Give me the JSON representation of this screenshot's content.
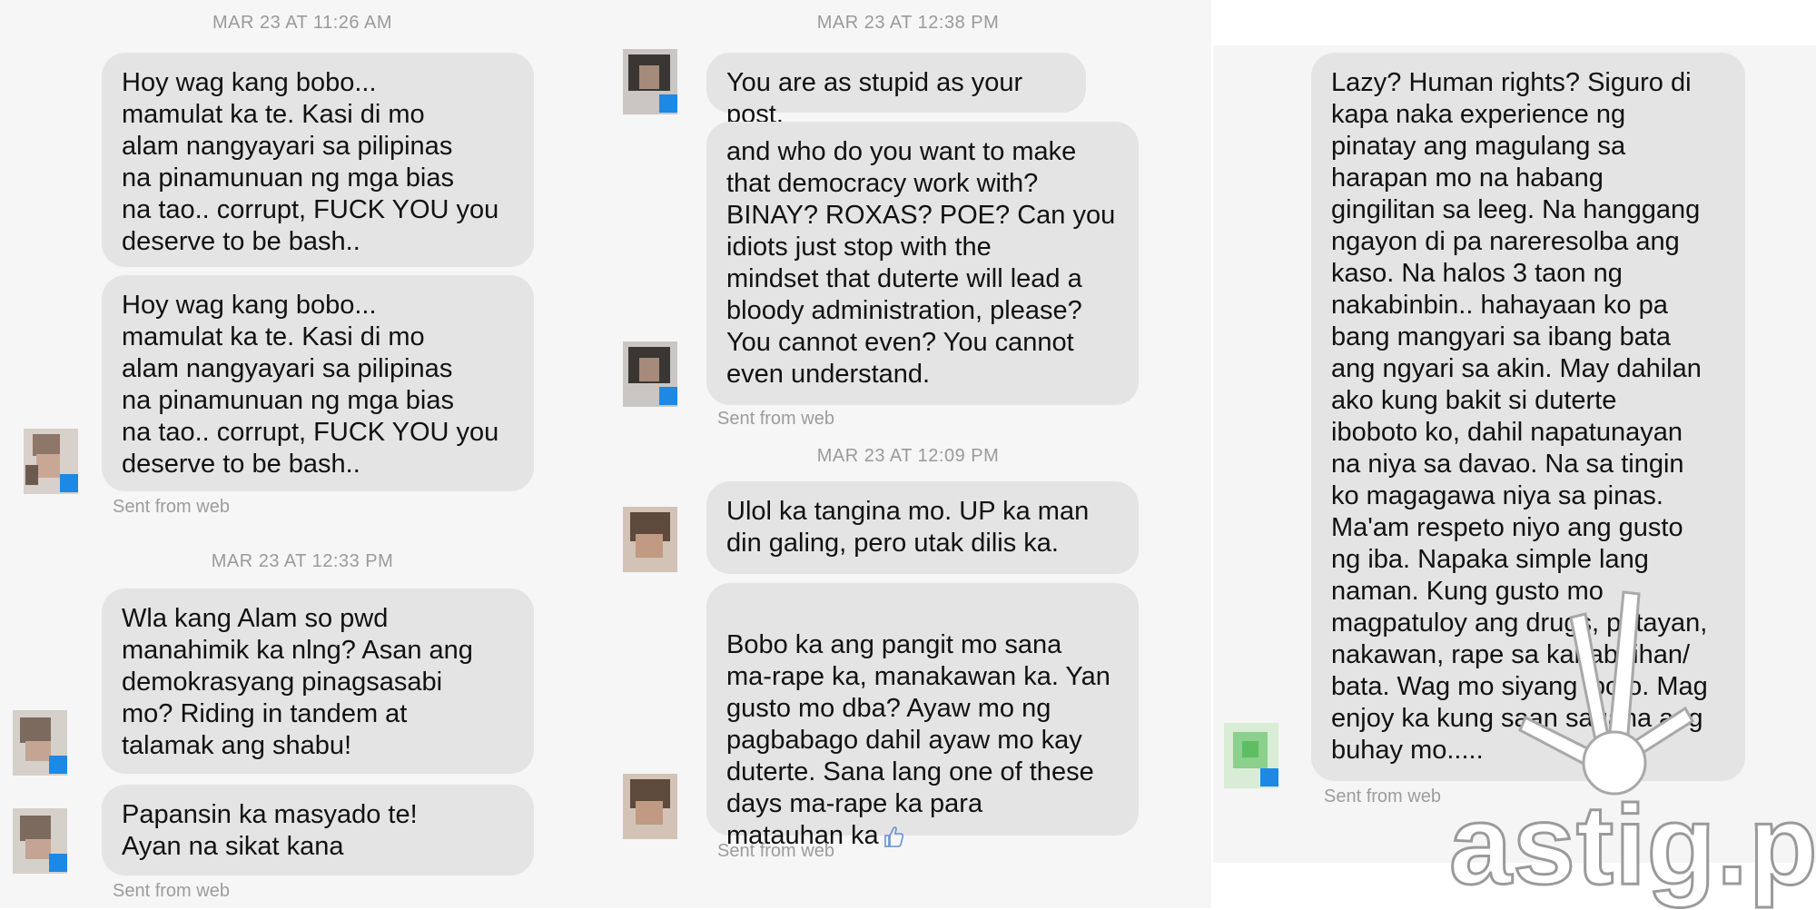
{
  "panel1": {
    "timestamp_top": "MAR 23 AT 11:26 AM",
    "msg1": "Hoy wag kang bobo...\nmamulat ka te. Kasi di mo\nalam nangyayari sa pilipinas\nna pinamunuan ng mga bias\nna tao.. corrupt, FUCK YOU you\ndeserve to be bash..",
    "msg2": "Hoy wag kang bobo...\nmamulat ka te. Kasi di mo\nalam nangyayari sa pilipinas\nna pinamunuan ng mga bias\nna tao.. corrupt, FUCK YOU you\ndeserve to be bash..",
    "sent1": "Sent from web",
    "timestamp_mid": "MAR 23 AT 12:33 PM",
    "msg3": "Wla kang Alam so pwd\nmanahimik ka nlng? Asan ang\ndemokrasyang pinagsasabi\nmo? Riding in tandem at\ntalamak ang shabu!",
    "msg4": "Papansin ka masyado te!\nAyan na sikat kana",
    "sent2": "Sent from web"
  },
  "panel2": {
    "timestamp_top": "MAR 23 AT 12:38 PM",
    "msg1": "You are as stupid as your post.",
    "msg2": "and who do you want to make\nthat democracy work with?\nBINAY? ROXAS? POE? Can you\nidiots just stop with the\nmindset that duterte will lead a\nbloody administration, please?\nYou cannot even? You cannot\neven understand.",
    "sent1": "Sent from web",
    "timestamp_mid": "MAR 23 AT 12:09 PM",
    "msg3": "Ulol ka tangina mo. UP ka man\ndin galing, pero utak dilis ka.",
    "msg4": "Bobo ka ang pangit mo sana\nma-rape ka, manakawan ka. Yan\ngusto mo dba? Ayaw mo ng\npagbabago dahil ayaw mo kay\nduterte. Sana lang one of these\ndays ma-rape ka para\nmatauhan ka",
    "sent2": "Sent from web"
  },
  "panel3": {
    "msg1": "Lazy? Human rights? Siguro di\nkapa naka experience ng\npinatay ang magulang sa\nharapan mo na habang\ngingilitan sa leeg. Na hanggang\nngayon di pa nareresolba ang\nkaso. Na halos 3 taon ng\nnakabinbin.. hahayaan ko pa\nbang mangyari sa ibang bata\nang ngyari sa akin. May dahilan\nako kung bakit si duterte\niboboto ko, dahil napatunayan\nna niya sa davao. Na sa tingin\nko magagawa niya sa pinas.\nMa'am respeto niyo ang gusto\nng iba. Napaka simple lang\nnaman. Kung gusto mo\nmagpatuloy ang drugs, patayan,\nnakawan, rape sa kababaihan/\nbata. Wag mo siyang iboto. Mag\nenjoy ka kung saan sagana ang\nbuhay mo.....",
    "sent1": "Sent from web"
  },
  "watermark": {
    "text": "astig.ph"
  },
  "icons": {
    "thumbs_up": "thumbs-up-icon"
  },
  "colors": {
    "bubble": "#e4e4e4",
    "meta_text": "#9a9a9a",
    "messenger_badge": "#1e88e5"
  }
}
